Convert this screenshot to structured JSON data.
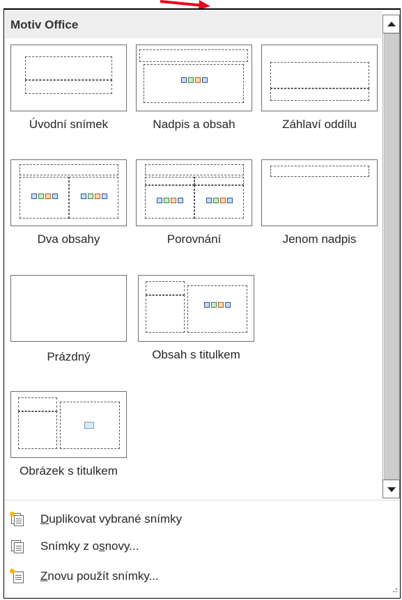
{
  "gallery": {
    "header": "Motiv Office"
  },
  "layouts": [
    {
      "label": "Úvodní snímek"
    },
    {
      "label": "Nadpis a obsah"
    },
    {
      "label": "Záhlaví oddílu"
    },
    {
      "label": "Dva obsahy"
    },
    {
      "label": "Porovnání"
    },
    {
      "label": "Jenom nadpis"
    },
    {
      "label": "Prázdný"
    },
    {
      "label": "Obsah s titulkem"
    },
    {
      "label": "Obrázek s titulkem"
    }
  ],
  "menu": {
    "duplicate": {
      "pre": "",
      "key": "D",
      "post": "uplikovat vybrané snímky"
    },
    "outline": {
      "pre": "Snímky z o",
      "key": "s",
      "post": "novy..."
    },
    "reuse": {
      "pre": "",
      "key": "Z",
      "post": "novu použít snímky..."
    }
  },
  "colors": {
    "accent_arrow": "#e8001c",
    "thumbnail_border": "#6d6d6d",
    "header_bg": "#eeeeee"
  }
}
